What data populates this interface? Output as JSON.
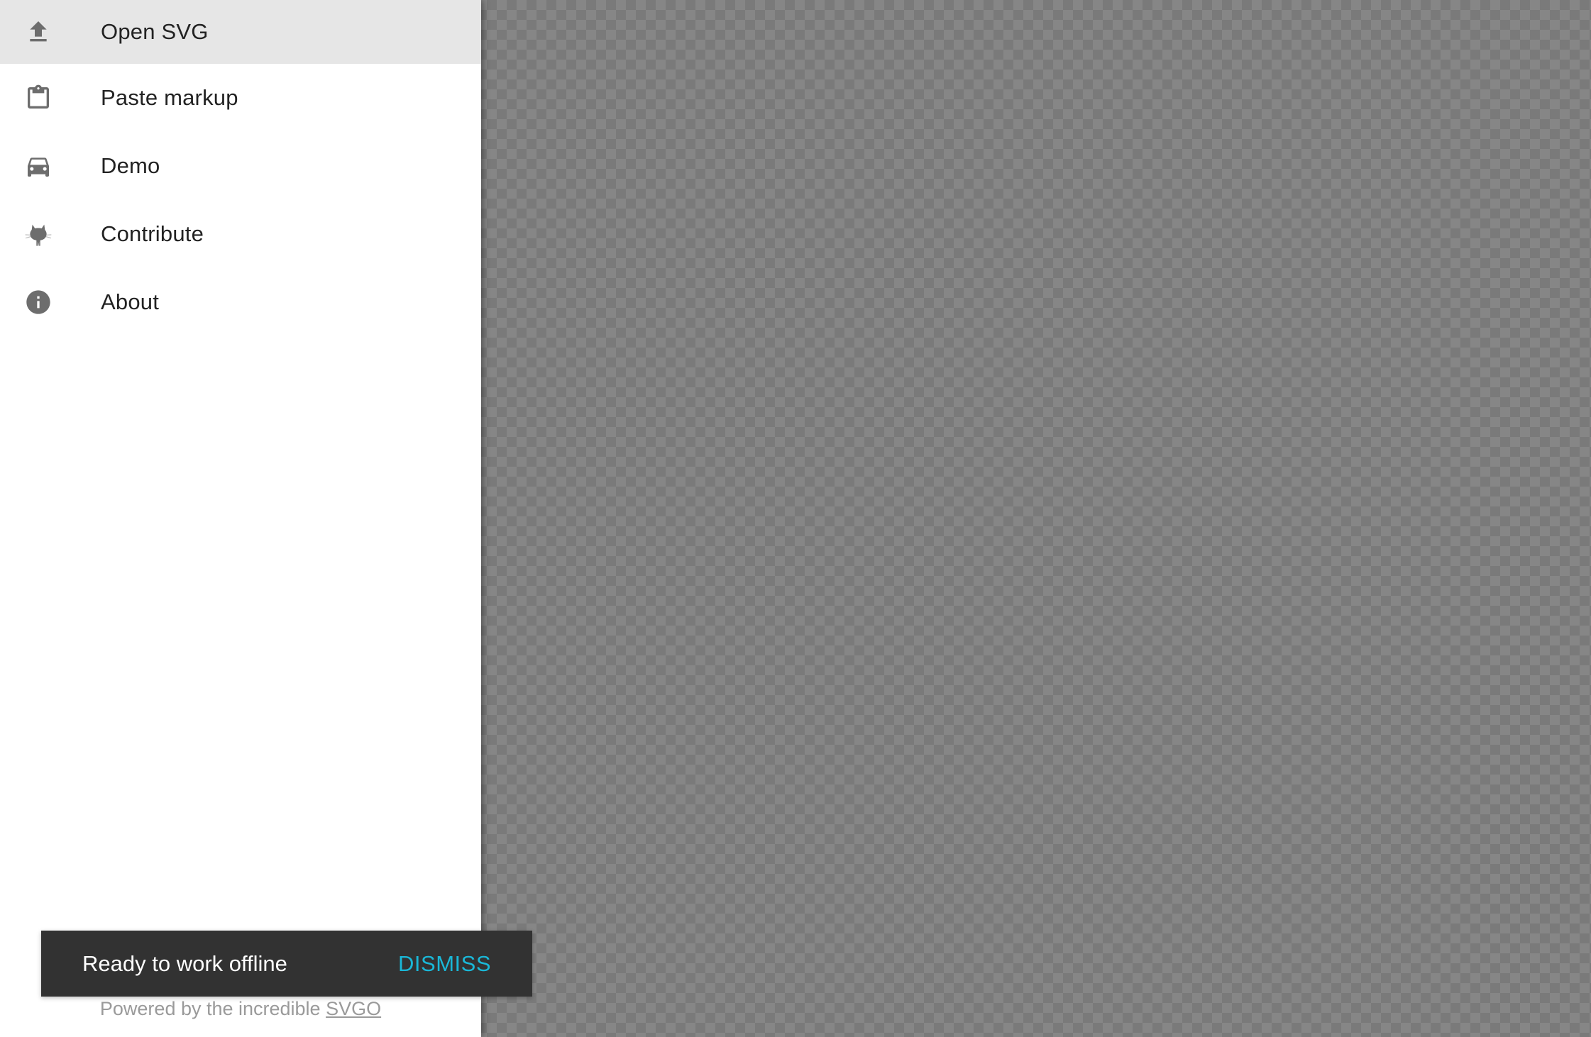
{
  "menu": {
    "items": [
      {
        "label": "Open SVG",
        "icon": "upload-icon",
        "active": true
      },
      {
        "label": "Paste markup",
        "icon": "clipboard-icon",
        "active": false
      },
      {
        "label": "Demo",
        "icon": "car-icon",
        "active": false
      },
      {
        "label": "Contribute",
        "icon": "github-octocat-icon",
        "active": false
      },
      {
        "label": "About",
        "icon": "info-icon",
        "active": false
      }
    ]
  },
  "footer": {
    "text": "Powered by the incredible ",
    "link_label": "SVGO"
  },
  "snackbar": {
    "message": "Ready to work offline",
    "action_label": "DISMISS"
  },
  "colors": {
    "accent": "#1ab8d8",
    "snackbar_bg": "#323232",
    "active_item_bg": "#e6e6e6",
    "icon": "#6d6d6d"
  }
}
